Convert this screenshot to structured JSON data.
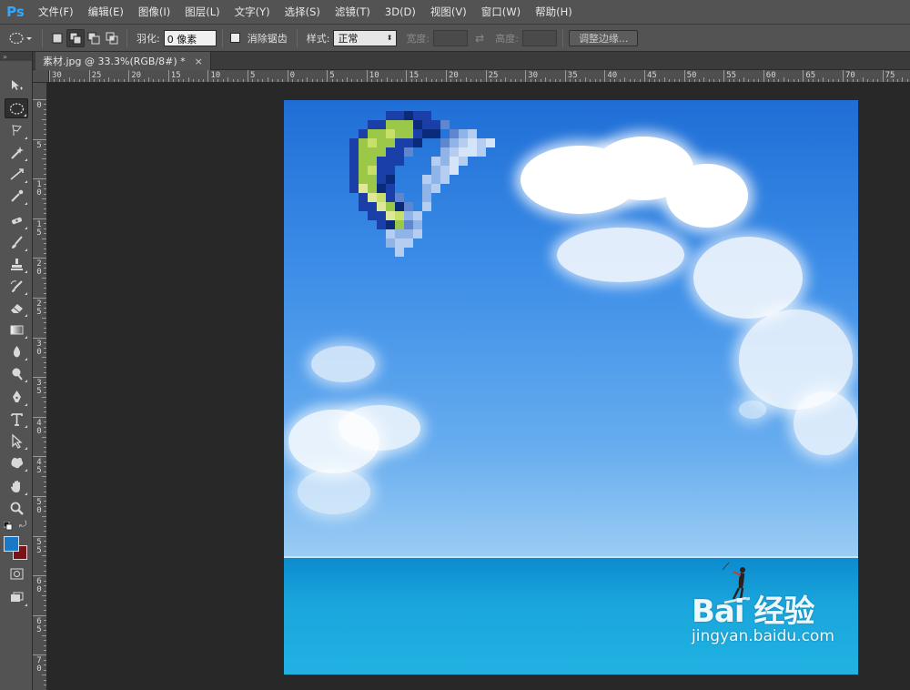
{
  "app": {
    "logo": "Ps"
  },
  "menu": [
    "文件(F)",
    "编辑(E)",
    "图像(I)",
    "图层(L)",
    "文字(Y)",
    "选择(S)",
    "滤镜(T)",
    "3D(D)",
    "视图(V)",
    "窗口(W)",
    "帮助(H)"
  ],
  "options": {
    "feather_label": "羽化:",
    "feather_value": "0 像素",
    "antialias_label": "消除锯齿",
    "style_label": "样式:",
    "style_value": "正常",
    "width_label": "宽度:",
    "height_label": "高度:",
    "refine_edge_label": "调整边缘..."
  },
  "document": {
    "tab_title": "素材.jpg @ 33.3%(RGB/8#) *",
    "close_glyph": "×"
  },
  "ruler": {
    "horizontal": [
      "30",
      "25",
      "20",
      "15",
      "10",
      "5",
      "0",
      "5",
      "10",
      "15",
      "20",
      "25",
      "30",
      "35",
      "40",
      "45",
      "50",
      "55",
      "60",
      "65",
      "70",
      "75"
    ],
    "vertical": [
      "0",
      "5",
      "10",
      "15",
      "20",
      "25",
      "30",
      "35",
      "40",
      "45",
      "50",
      "55",
      "60",
      "65",
      "70"
    ]
  },
  "image": {
    "watermark_logo": "Bai 经验",
    "watermark_url": "jingyan.baidu.com"
  },
  "colors": {
    "foreground": "#1a78c8",
    "background": "#7a1219",
    "accent": "#31a8ff"
  },
  "tools": [
    "move-tool",
    "elliptical-marquee-tool",
    "lasso-tool",
    "quick-selection-tool",
    "crop-tool",
    "eyedropper-tool",
    "spot-healing-tool",
    "brush-tool",
    "clone-stamp-tool",
    "history-brush-tool",
    "eraser-tool",
    "gradient-tool",
    "blur-tool",
    "dodge-tool",
    "pen-tool",
    "type-tool",
    "path-selection-tool",
    "custom-shape-tool",
    "hand-tool",
    "zoom-tool"
  ]
}
